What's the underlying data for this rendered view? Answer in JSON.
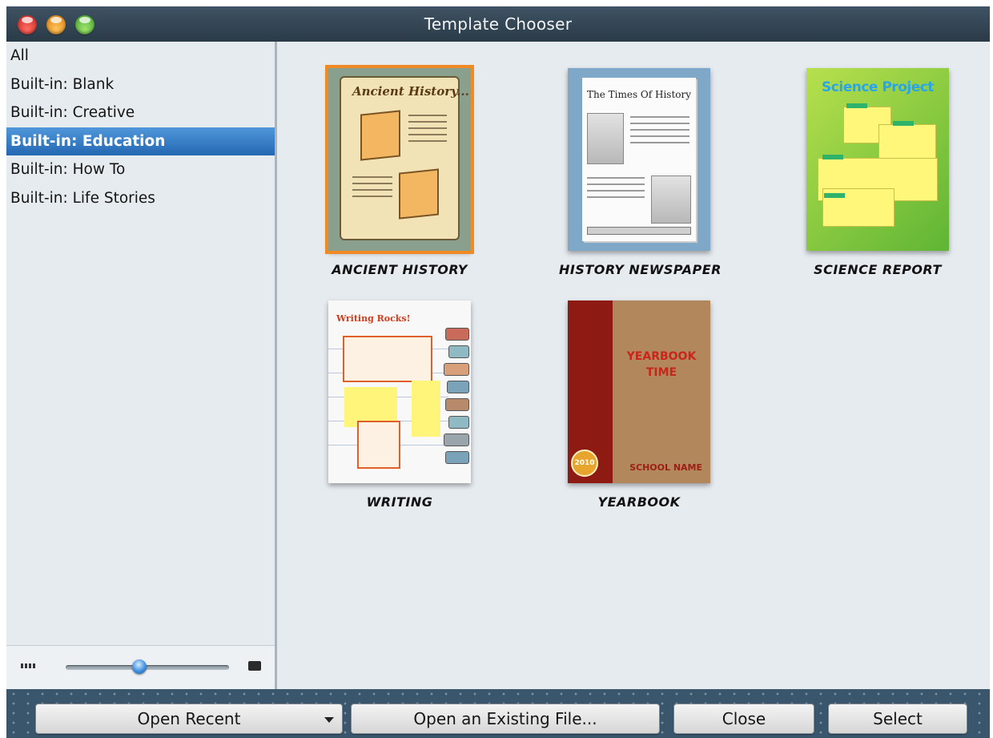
{
  "window": {
    "title": "Template Chooser"
  },
  "sidebar": {
    "categories": [
      {
        "label": "All"
      },
      {
        "label": "Built-in: Blank"
      },
      {
        "label": "Built-in: Creative"
      },
      {
        "label": "Built-in: Education",
        "selected": true
      },
      {
        "label": "Built-in: How To"
      },
      {
        "label": "Built-in: Life Stories"
      }
    ],
    "zoom": {
      "level": 0.45
    }
  },
  "templates": [
    {
      "label": "ANCIENT HISTORY",
      "thumb_text": "Ancient History...",
      "selected": true
    },
    {
      "label": "HISTORY NEWSPAPER",
      "thumb_text": "The Times Of History"
    },
    {
      "label": "SCIENCE REPORT",
      "thumb_text": "Science Project"
    },
    {
      "label": "WRITING",
      "thumb_text": "Writing Rocks!"
    },
    {
      "label": "YEARBOOK",
      "thumb_text": "YEARBOOK TIME",
      "thumb_text_2": "SCHOOL NAME",
      "thumb_badge": "2010"
    }
  ],
  "buttons": {
    "open_recent": "Open Recent",
    "open_existing": "Open an Existing File...",
    "close": "Close",
    "select": "Select"
  },
  "colors": {
    "selection_blue": "#2f75c2",
    "thumbnail_highlight": "#f08a24",
    "titlebar": "#34495a"
  }
}
